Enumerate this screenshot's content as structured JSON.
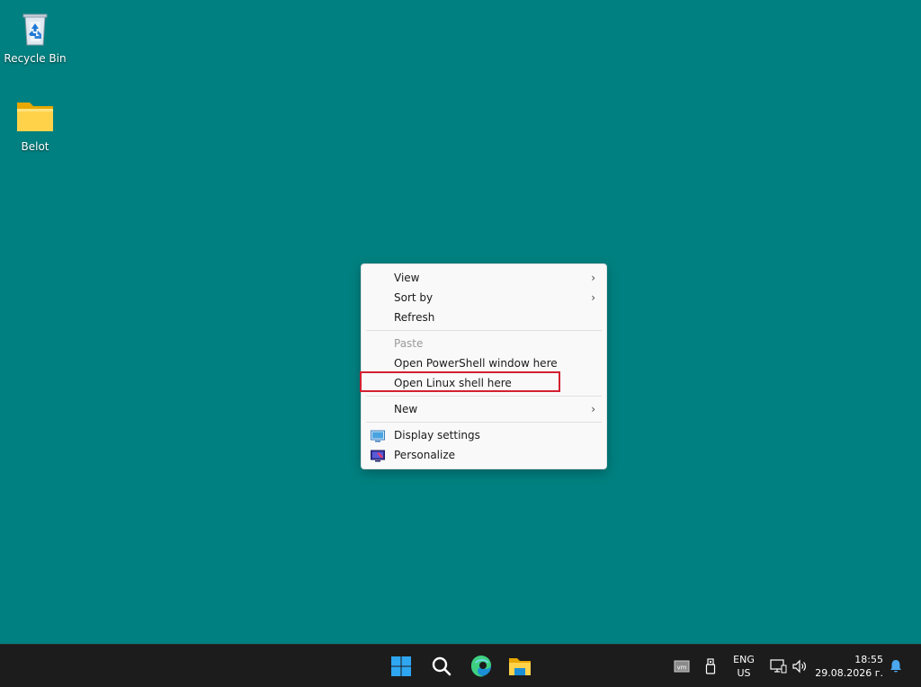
{
  "desktop": {
    "icons": [
      {
        "label": "Recycle Bin",
        "icon": "recycle-bin-icon"
      },
      {
        "label": "Belot",
        "icon": "folder-icon"
      }
    ],
    "background_color": "#008080"
  },
  "context_menu": {
    "items": [
      {
        "label": "View",
        "submenu": true
      },
      {
        "label": "Sort by",
        "submenu": true
      },
      {
        "label": "Refresh"
      },
      {
        "label": "Paste",
        "disabled": true
      },
      {
        "label": "Open PowerShell window here"
      },
      {
        "label": "Open Linux shell here",
        "highlighted": true
      },
      {
        "label": "New",
        "submenu": true
      },
      {
        "label": "Display settings",
        "icon": "display-icon"
      },
      {
        "label": "Personalize",
        "icon": "personalize-icon"
      }
    ],
    "submenu_arrow": "›",
    "highlight_color": "#d32030"
  },
  "taskbar": {
    "apps": [
      {
        "icon": "windows-start-icon"
      },
      {
        "icon": "search-icon"
      },
      {
        "icon": "edge-browser-icon"
      },
      {
        "icon": "file-explorer-icon"
      }
    ],
    "tray": {
      "vm_badge": "vm",
      "language_line1": "ENG",
      "language_line2": "US",
      "time": "18:55",
      "date": "29.08.2026 г."
    }
  }
}
